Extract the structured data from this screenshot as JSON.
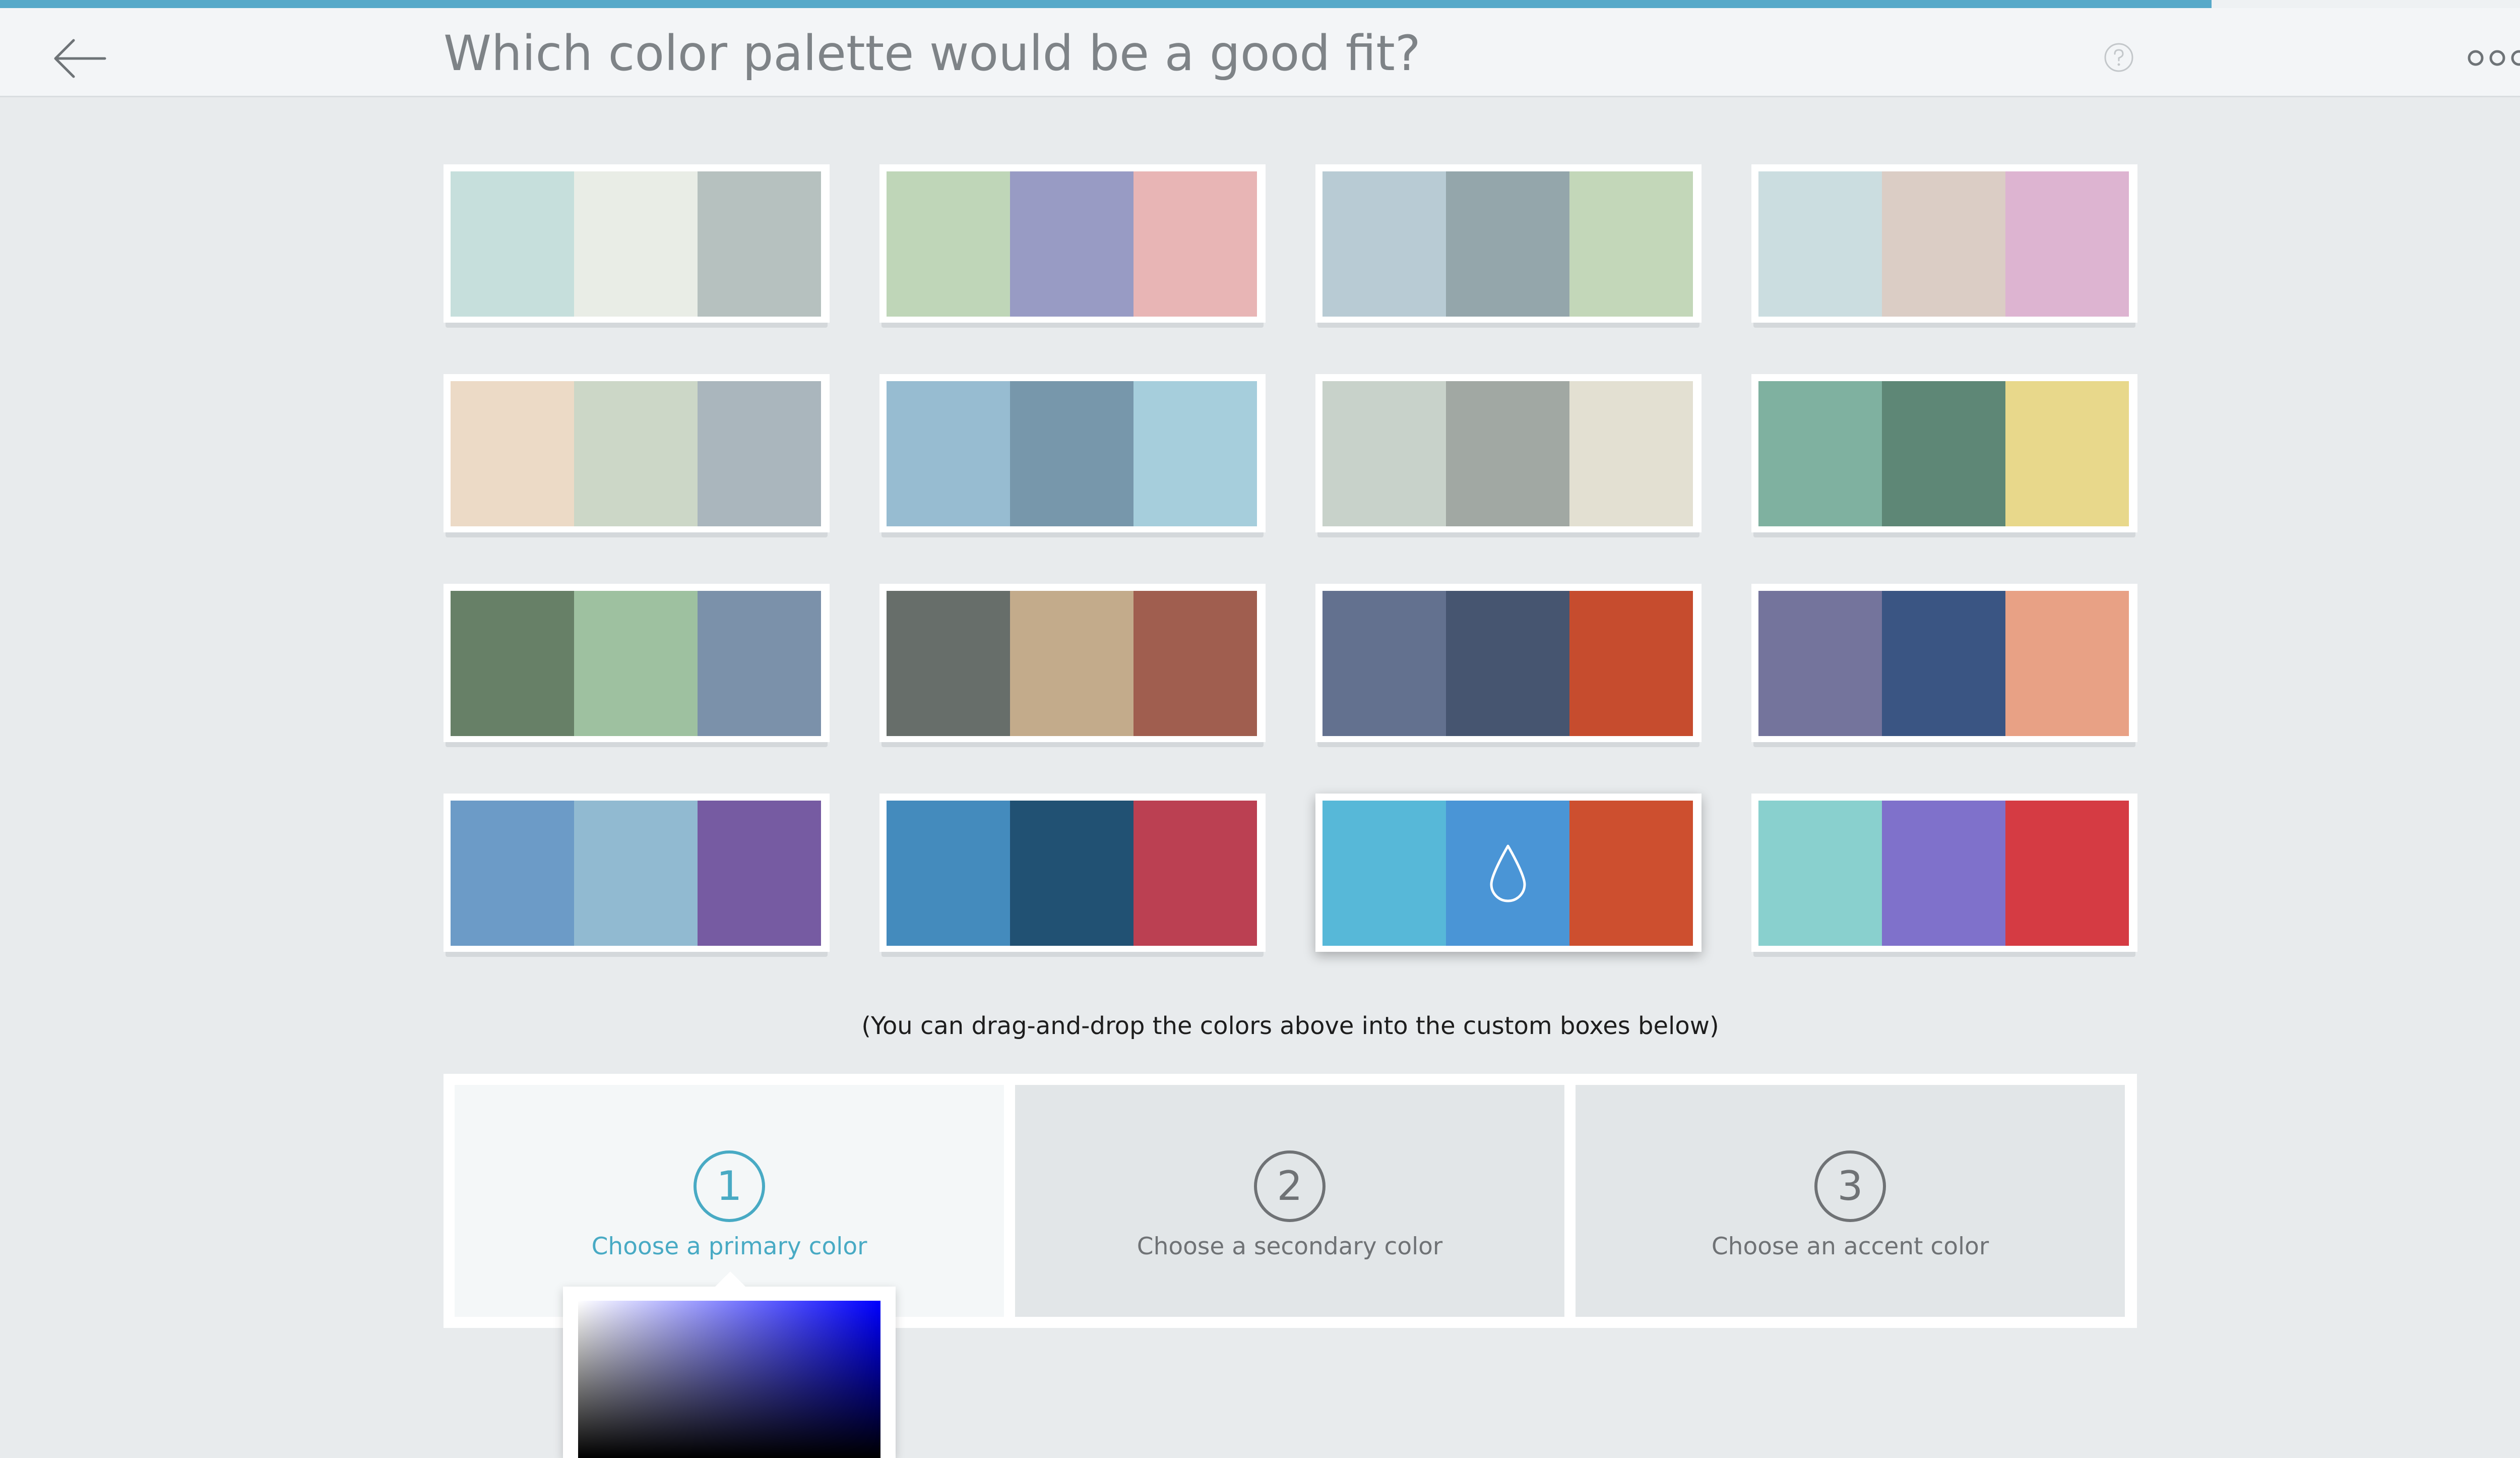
{
  "progress": {
    "fraction": 0.857
  },
  "header": {
    "title": "Which color palette would be a good fit?",
    "back_icon": "arrow-left-icon",
    "help_icon": "help-circle-icon",
    "more_icon": "more-horizontal-icon"
  },
  "palettes": [
    {
      "colors": [
        "#c6dfdc",
        "#e9ede6",
        "#b6c1bf"
      ]
    },
    {
      "colors": [
        "#bfd6b8",
        "#989bc4",
        "#e8b5b5"
      ]
    },
    {
      "colors": [
        "#b8cbd4",
        "#94a6ab",
        "#c3d7b9"
      ]
    },
    {
      "colors": [
        "#cbdde0",
        "#dbcdc5",
        "#ddb4d1"
      ]
    },
    {
      "colors": [
        "#ecdac6",
        "#ccd7c7",
        "#aab6bd"
      ]
    },
    {
      "colors": [
        "#97bcd1",
        "#7797ab",
        "#a6cedc"
      ]
    },
    {
      "colors": [
        "#c8d2ca",
        "#a1a8a3",
        "#e3e0d2"
      ]
    },
    {
      "colors": [
        "#7fb1a0",
        "#5e8776",
        "#e8d88b"
      ]
    },
    {
      "colors": [
        "#678067",
        "#9ec1a0",
        "#7b91aa"
      ]
    },
    {
      "colors": [
        "#676e6a",
        "#c3ab8b",
        "#a05e4f"
      ]
    },
    {
      "colors": [
        "#63718f",
        "#465570",
        "#c64c2e"
      ]
    },
    {
      "colors": [
        "#74749c",
        "#3a5583",
        "#e8a185"
      ]
    },
    {
      "colors": [
        "#6c9bc7",
        "#91bad1",
        "#765ba2"
      ]
    },
    {
      "colors": [
        "#448bbd",
        "#215173",
        "#bb4052"
      ]
    },
    {
      "colors": [
        "#57b8d8",
        "#4a95d6",
        "#cd4f2f"
      ],
      "selected": true,
      "drop_icon": "water-drop-icon"
    },
    {
      "colors": [
        "#89d0ce",
        "#7f71cb",
        "#d53b43"
      ]
    }
  ],
  "instructions": "(You can drag-and-drop the colors above into the custom boxes below)",
  "custom": {
    "slots": [
      {
        "num": "1",
        "label": "Choose a primary color",
        "active": true
      },
      {
        "num": "2",
        "label": "Choose a secondary color",
        "active": false
      },
      {
        "num": "3",
        "label": "Choose an accent color",
        "active": false
      }
    ]
  },
  "colors": {
    "accent": "#48aac4",
    "progress": "#57a9c9",
    "background": "#e8ebed",
    "picker_hue": "#0000ff"
  }
}
